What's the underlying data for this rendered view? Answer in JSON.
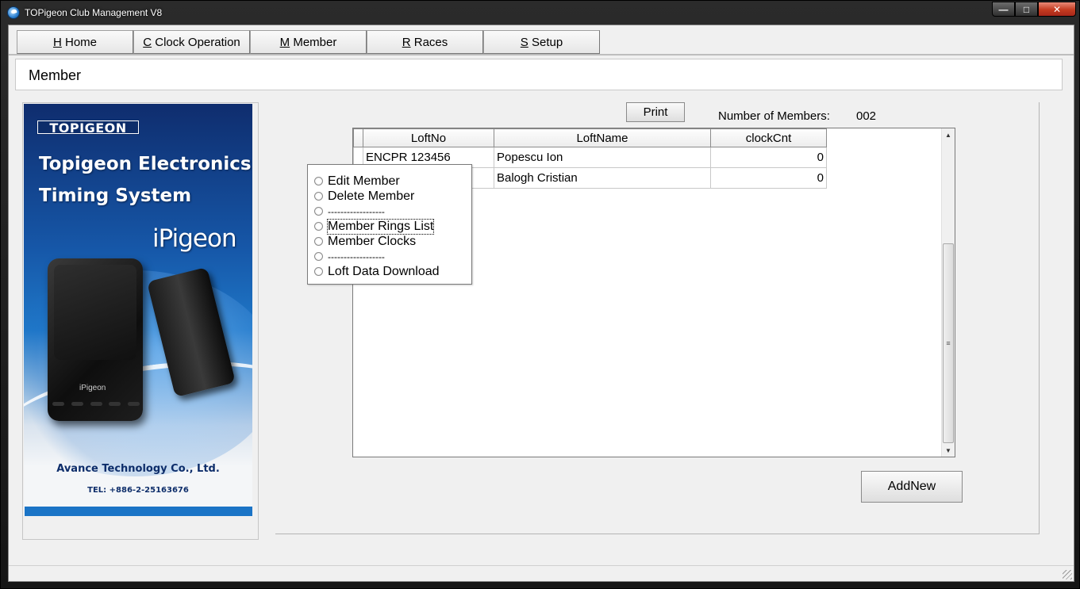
{
  "window": {
    "title": "TOPigeon Club Management V8",
    "caption_min": "—",
    "caption_max": "□",
    "caption_close": "✕"
  },
  "tabs": [
    {
      "hotkey": "H",
      "label": " Home"
    },
    {
      "hotkey": "C",
      "label": " Clock Operation"
    },
    {
      "hotkey": "M",
      "label": " Member"
    },
    {
      "hotkey": "R",
      "label": " Races"
    },
    {
      "hotkey": "S",
      "label": " Setup"
    }
  ],
  "page": {
    "title": "Member"
  },
  "banner": {
    "logo": "TOPIGEON",
    "headline_line1": "Topigeon Electronics",
    "headline_line2": "Timing System",
    "product": "iPigeon",
    "device_label": "iPigeon",
    "company": "Avance Technology Co., Ltd.",
    "tel": "TEL: +886-2-25163676",
    "colors": {
      "dark_blue": "#0d2d6a",
      "blue": "#1b74c6"
    }
  },
  "toolbar": {
    "print_label": "Print",
    "count_label": "Number of Members:",
    "count_value": "002"
  },
  "grid": {
    "columns": [
      "LoftNo",
      "LoftName",
      "clockCnt"
    ],
    "rows": [
      {
        "loftno": "ENCPR 123456",
        "loftname": "Popescu Ion",
        "clockcnt": "0"
      },
      {
        "loftno": "",
        "loftname": "Balogh Cristian",
        "clockcnt": "0"
      }
    ],
    "scroll_up": "▲",
    "scroll_down": "▼",
    "scroll_grip": "≡"
  },
  "context_menu": {
    "items": [
      "Edit Member",
      "Delete Member",
      "------------------",
      "Member Rings List",
      "Member Clocks",
      "------------------",
      "Loft Data Download"
    ]
  },
  "addnew_label": "AddNew"
}
